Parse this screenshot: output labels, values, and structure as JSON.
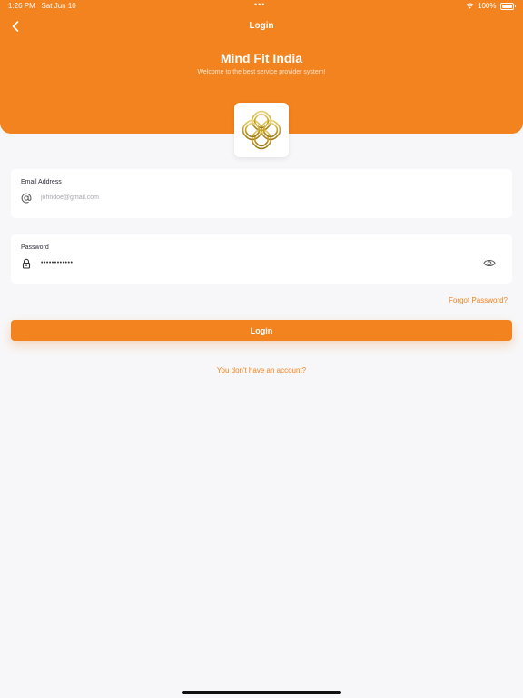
{
  "status_bar": {
    "time": "1:26 PM",
    "date": "Sat Jun 10",
    "battery": "100%"
  },
  "nav": {
    "title": "Login",
    "back_icon": "chevron-left-icon"
  },
  "header": {
    "title": "Mind Fit India",
    "subtitle": "Welcome to the best service provider system!",
    "color": "#f2831f"
  },
  "form": {
    "email": {
      "label": "Email Address",
      "placeholder": "johndoe@gmail.com",
      "value": "",
      "icon": "at-icon"
    },
    "password": {
      "label": "Password",
      "value": "••••••••••••",
      "icon": "lock-icon",
      "toggle_icon": "eye-icon"
    },
    "forgot_label": "Forgot Password?",
    "submit_label": "Login",
    "signup_label": "You don't have an account?"
  }
}
